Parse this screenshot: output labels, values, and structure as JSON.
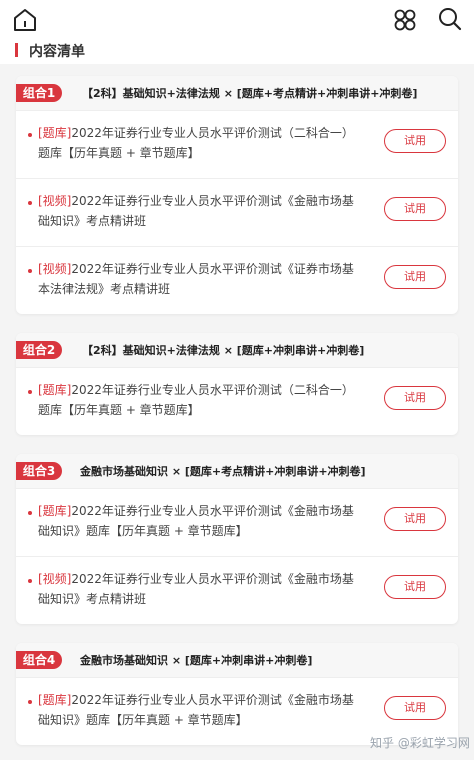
{
  "toolbar": {
    "home_icon": "home-icon",
    "apps_icon": "apps-icon",
    "search_icon": "search-icon"
  },
  "section": {
    "title": "内容清单"
  },
  "accent_color": "#d9363e",
  "groups": [
    {
      "badge": "组合1",
      "title": "【2科】基础知识+法律法规 × [题库+考点精讲+冲刺串讲+冲刺卷]",
      "items": [
        {
          "tag": "[题库]",
          "text": "2022年证券行业专业人员水平评价测试（二科合一）题库【历年真题 + 章节题库】",
          "button": "试用"
        },
        {
          "tag": "[视频]",
          "text": "2022年证券行业专业人员水平评价测试《金融市场基础知识》考点精讲班",
          "button": "试用"
        },
        {
          "tag": "[视频]",
          "text": "2022年证券行业专业人员水平评价测试《证券市场基本法律法规》考点精讲班",
          "button": "试用"
        }
      ]
    },
    {
      "badge": "组合2",
      "title": "【2科】基础知识+法律法规 × [题库+冲刺串讲+冲刺卷]",
      "items": [
        {
          "tag": "[题库]",
          "text": "2022年证券行业专业人员水平评价测试（二科合一）题库【历年真题 + 章节题库】",
          "button": "试用"
        }
      ]
    },
    {
      "badge": "组合3",
      "title": "金融市场基础知识 × [题库+考点精讲+冲刺串讲+冲刺卷]",
      "items": [
        {
          "tag": "[题库]",
          "text": "2022年证券行业专业人员水平评价测试《金融市场基础知识》题库【历年真题 + 章节题库】",
          "button": "试用"
        },
        {
          "tag": "[视频]",
          "text": "2022年证券行业专业人员水平评价测试《金融市场基础知识》考点精讲班",
          "button": "试用"
        }
      ]
    },
    {
      "badge": "组合4",
      "title": "金融市场基础知识 × [题库+冲刺串讲+冲刺卷]",
      "items": [
        {
          "tag": "[题库]",
          "text": "2022年证券行业专业人员水平评价测试《金融市场基础知识》题库【历年真题 + 章节题库】",
          "button": "试用"
        }
      ]
    }
  ],
  "watermark": "知乎 @彩虹学习网"
}
